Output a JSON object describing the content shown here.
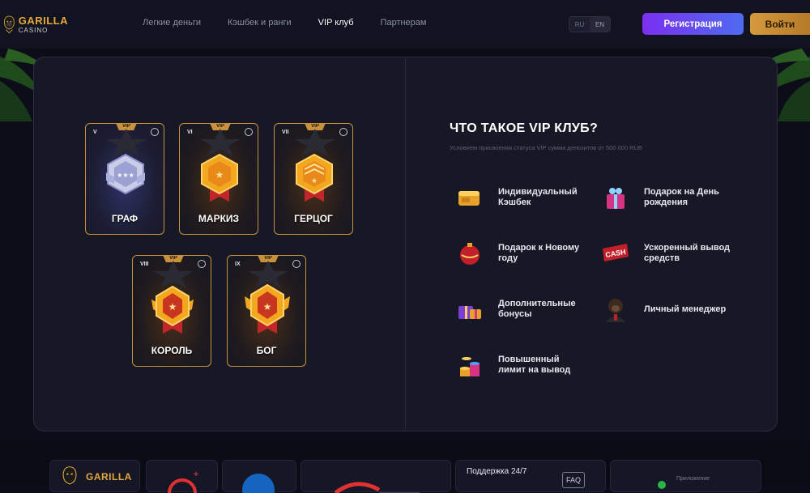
{
  "header": {
    "logo_line1": "GARILLA",
    "logo_line2": "CASINO",
    "nav": [
      {
        "label": "Легкие деньги",
        "active": false
      },
      {
        "label": "Кэшбек и ранги",
        "active": false
      },
      {
        "label": "VIP клуб",
        "active": true
      },
      {
        "label": "Партнерам",
        "active": false
      }
    ],
    "lang": {
      "ru": "RU",
      "en": "EN",
      "selected": "RU"
    },
    "register_label": "Регистрация",
    "login_label": "Войти"
  },
  "cards": [
    {
      "numeral": "V",
      "vip": "VIP",
      "name": "ГРАФ",
      "tier": "silver"
    },
    {
      "numeral": "VI",
      "vip": "VIP",
      "name": "МАРКИЗ",
      "tier": "gold"
    },
    {
      "numeral": "VII",
      "vip": "VIP",
      "name": "ГЕРЦОГ",
      "tier": "gold"
    },
    {
      "numeral": "VIII",
      "vip": "VIP",
      "name": "КОРОЛЬ",
      "tier": "gold"
    },
    {
      "numeral": "IX",
      "vip": "VIP",
      "name": "БОГ",
      "tier": "gold"
    }
  ],
  "vip_info": {
    "title": "ЧТО ТАКОЕ VIP КЛУБ?",
    "subtitle": "Условием присвоения статуса VIP сумма депозитов от 500 000 RUB"
  },
  "features": [
    {
      "label": "Индивидуальный Кэшбек",
      "icon": "gold-bars-icon"
    },
    {
      "label": "Подарок на День рождения",
      "icon": "gift-box-icon"
    },
    {
      "label": "Подарок к Новому году",
      "icon": "christmas-ornament-icon"
    },
    {
      "label": "Ускоренный вывод средств",
      "icon": "cash-sign-icon"
    },
    {
      "label": "Дополнительные бонусы",
      "icon": "gift-pile-icon"
    },
    {
      "label": "Личный менеджер",
      "icon": "gorilla-manager-icon"
    },
    {
      "label": "Повышенный лимит на вывод",
      "icon": "coin-stack-icon"
    }
  ],
  "footer": {
    "logo_text": "GARILLA",
    "support_label": "Поддержка 24/7",
    "faq_label": "FAQ",
    "app_label": "Приложение"
  }
}
